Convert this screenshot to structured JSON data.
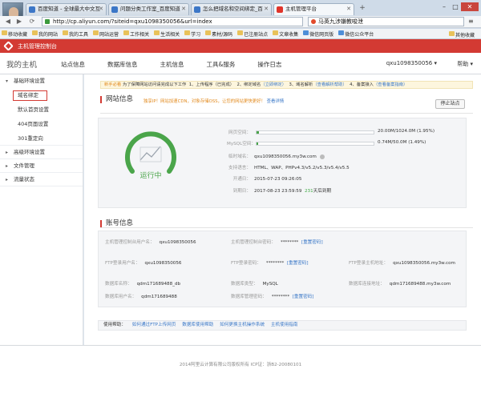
{
  "browser": {
    "tabs": [
      {
        "label": "百度知道 - 全球最大中文互"
      },
      {
        "label": "问题分类工作室_百度知道"
      },
      {
        "label": "怎么把域名和空间绑定_百"
      },
      {
        "label": "主机管理平台",
        "active": true
      }
    ],
    "new_tab": "+",
    "url": "http://cp.aliyun.com/?siteid=qxu1098350056&url=index",
    "search": "马英九涉嫌教唆泄",
    "bookmarks": [
      "移动收藏",
      "我的网站",
      "我的工具",
      "网站运营",
      "工作相关",
      "生活相关",
      "学习",
      "素材/源码",
      "已注册站点",
      "文章收集",
      "微信网页版",
      "微信公众平台"
    ],
    "bookmarks_other": "其他收藏"
  },
  "pagebar": {
    "title": "主机管理控制台"
  },
  "header": {
    "title": "我的主机",
    "nav": [
      "站点信息",
      "数据库信息",
      "主机信息",
      "工具&服务",
      "操作日志"
    ],
    "user": "qxu1098350056 ▾",
    "help": "帮助 ▾"
  },
  "sidebar": {
    "groups": [
      {
        "label": "基础环境设置",
        "open": true,
        "items": [
          "域名绑定",
          "默认首页设置",
          "404页面设置",
          "301重定向"
        ]
      },
      {
        "label": "高级环境设置"
      },
      {
        "label": "文件管理"
      },
      {
        "label": "流量状态"
      }
    ]
  },
  "notice": {
    "lead": "新手必看",
    "text": "为了保障网站访问请完成以下工作",
    "steps": [
      "1、上传程序（已完成）",
      "2、绑定域名",
      "（立即绑定）",
      "3、域名解析",
      "（查看解析帮助）",
      "4、备案接入",
      "（查看备案指南）"
    ]
  },
  "website": {
    "title": "网站信息",
    "promo_a": "独享IP！网站加速CDN，对象存储OSS，让您的网站更快更好！",
    "promo_link": "查看详情",
    "stop_button": "停止站点",
    "status_text": "运行中",
    "space_label": "网页空间：",
    "space_text": "20.00M/1024.0M (1.95%)",
    "space_pct": 1.95,
    "mysql_label": "MySQL空间：",
    "mysql_text": "0.74M/50.0M (1.49%)",
    "mysql_pct": 1.49,
    "domain_label": "临时域名：",
    "domain_value": "qxu1098350056.my3w.com",
    "lang_label": "支持语言：",
    "lang_value": "HTML、WAP、PHPv4.3/v5.2/v5.3/v5.4/v5.5",
    "open_label": "开通日：",
    "open_value": "2015-07-23 09:26:05",
    "expire_label": "到期日：",
    "expire_value": "2017-08-23 23:59:59",
    "days_value": "231",
    "days_suffix": "天后到期"
  },
  "account": {
    "title": "账号信息",
    "cp_user_label": "主机管理控制台用户名：",
    "cp_user_value": "qxu1098350056",
    "cp_pwd_label": "主机管理控制台密码：",
    "cp_pwd_value": "********",
    "reset": "[重置密码]",
    "ftp_user_label": "FTP登录用户名：",
    "ftp_user_value": "qxu1098350056",
    "ftp_pwd_label": "FTP登录密码：",
    "ftp_pwd_value": "********",
    "ftp_host_label": "FTP登录主机地址：",
    "ftp_host_value": "qxu1098350056.my3w.com",
    "db_name_label": "数据库名称：",
    "db_name_value": "qdm171689488_db",
    "db_type_label": "数据库类型：",
    "db_type_value": "MySQL",
    "db_host_label": "数据库连接地址：",
    "db_host_value": "qdm171689488.my3w.com",
    "db_user_label": "数据库用户名：",
    "db_user_value": "qdm171689488",
    "db_pwd_label": "数据库管理密码：",
    "db_pwd_value": "********"
  },
  "help": {
    "label": "使用帮助：",
    "links": [
      "如何通过FTP上传网页",
      "数据库使用帮助",
      "如何更换主机操作系统",
      "主机使用指南"
    ]
  },
  "footer": {
    "text": "2014阿里云计算有限公司版权所有 ICP证：浙B2-20080101"
  },
  "colors": {
    "brand_red": "#d33a33",
    "run_green": "#4aa54a",
    "link_blue": "#3a78c8"
  }
}
